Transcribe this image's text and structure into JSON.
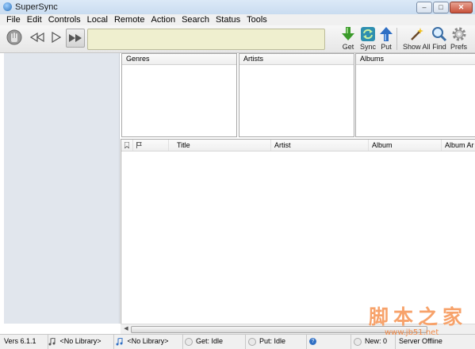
{
  "window": {
    "title": "SuperSync",
    "minimize_label": "–",
    "maximize_label": "□",
    "close_label": "✕"
  },
  "menu": [
    "File",
    "Edit",
    "Controls",
    "Local",
    "Remote",
    "Action",
    "Search",
    "Status",
    "Tools"
  ],
  "toolbar": {
    "get": "Get",
    "sync": "Sync",
    "put": "Put",
    "show_all": "Show All",
    "find": "Find",
    "prefs": "Prefs"
  },
  "browser": {
    "genres": "Genres",
    "artists": "Artists",
    "albums": "Albums"
  },
  "track_columns": [
    "Title",
    "Artist",
    "Album",
    "Album Ar"
  ],
  "status": {
    "version": "Vers 6.1.1",
    "local_library": "<No Library>",
    "remote_library": "<No Library>",
    "get_status": "Get: Idle",
    "put_status": "Put: Idle",
    "new_count": "New: 0",
    "server": "Server Offline"
  },
  "watermark": {
    "text": "脚本之家",
    "url": "www.jb51.net"
  },
  "icons": {
    "app": "supersync-app-icon",
    "stop": "hand-stop-icon",
    "rewind": "rewind-icon",
    "play": "play-icon",
    "fast_forward": "fast-forward-icon",
    "get": "download-arrow-icon",
    "sync": "sync-arrows-icon",
    "put": "upload-arrow-icon",
    "show_all": "magic-wand-icon",
    "find": "magnifier-icon",
    "prefs": "gear-icon"
  },
  "colors": {
    "display_bg": "#efefcf",
    "sidebar_bg": "#e1e6ed",
    "get_green": "#3a9a2a",
    "put_blue": "#2f6fc4"
  }
}
